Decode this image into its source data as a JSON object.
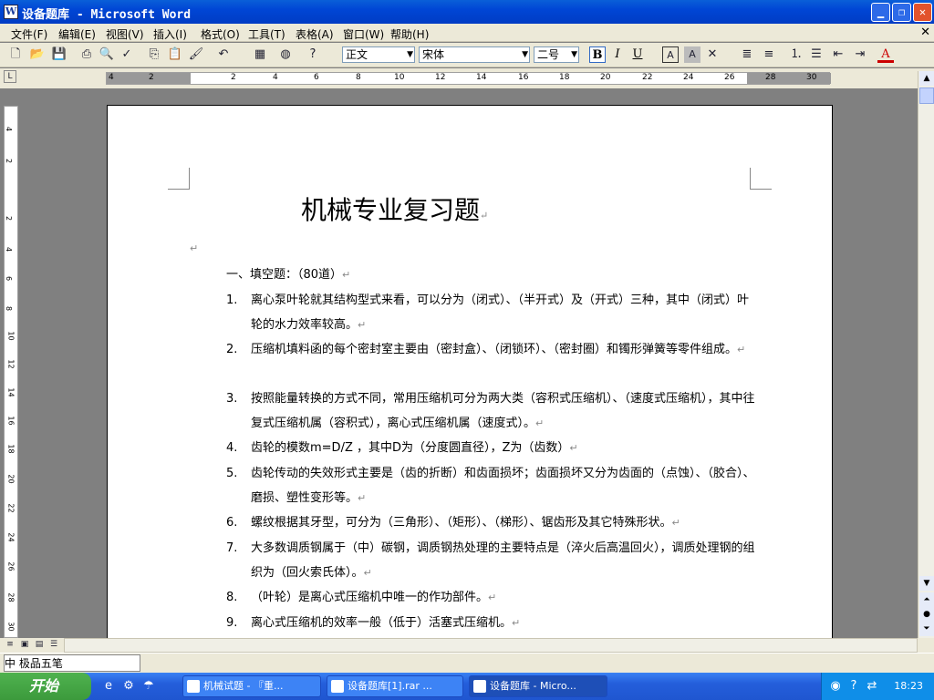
{
  "window": {
    "title": "设备题库 - Microsoft Word"
  },
  "menu": [
    "文件(F)",
    "编辑(E)",
    "视图(V)",
    "插入(I)",
    "格式(O)",
    "工具(T)",
    "表格(A)",
    "窗口(W)",
    "帮助(H)"
  ],
  "toolbar": {
    "style": "正文",
    "font": "宋体",
    "size": "二号",
    "bold": "B",
    "italic": "I",
    "underline": "U",
    "font_color": "A"
  },
  "ruler_numbers": [
    "4",
    "2",
    "2",
    "4",
    "6",
    "8",
    "10",
    "12",
    "14",
    "16",
    "18",
    "20",
    "22",
    "24",
    "26",
    "28",
    "30"
  ],
  "vruler_numbers": [
    "4",
    "2",
    "2",
    "4",
    "6",
    "8",
    "10",
    "12",
    "14",
    "16",
    "18",
    "20",
    "22",
    "24",
    "26",
    "28",
    "30"
  ],
  "document": {
    "title": "机械专业复习题",
    "section": "一、填空题：（80道）",
    "items": [
      {
        "num": "1.",
        "text": "离心泵叶轮就其结构型式来看，可以分为（闭式）、（半开式）及（开式）三种，其中（闭式）叶轮的水力效率较高。"
      },
      {
        "num": "2.",
        "text": "压缩机填料函的每个密封室主要由（密封盒）、（闭锁环）、（密封圈）和镯形弹簧等零件组成。"
      },
      {
        "num": "3.",
        "text": "按照能量转换的方式不同，常用压缩机可分为两大类（容积式压缩机）、（速度式压缩机），其中往复式压缩机属（容积式），离心式压缩机属（速度式）。"
      },
      {
        "num": "4.",
        "text": "齿轮的模数m=D/Z ，其中D为（分度圆直径），Z为（齿数）"
      },
      {
        "num": "5.",
        "text": "齿轮传动的失效形式主要是（齿的折断）和齿面损坏；齿面损坏又分为齿面的（点蚀）、（胶合）、磨损、塑性变形等。"
      },
      {
        "num": "6.",
        "text": "螺纹根据其牙型，可分为（三角形）、（矩形）、（梯形）、锯齿形及其它特殊形状。"
      },
      {
        "num": "7.",
        "text": "大多数调质钢属于（中）碳钢，调质钢热处理的主要特点是（淬火后高温回火），调质处理钢的组织为（回火索氏体）。"
      },
      {
        "num": "8.",
        "text": "（叶轮）是离心式压缩机中唯一的作功部件。"
      },
      {
        "num": "9.",
        "text": "离心式压缩机的效率一般（低于）活塞式压缩机。"
      }
    ]
  },
  "statusbar": {
    "ime": "中 极品五笔"
  },
  "taskbar": {
    "start": "开始",
    "tasks": [
      "机械试题 - 『重...",
      "设备题库[1].rar ...",
      "设备题库 - Micro..."
    ],
    "clock": "18:23"
  }
}
